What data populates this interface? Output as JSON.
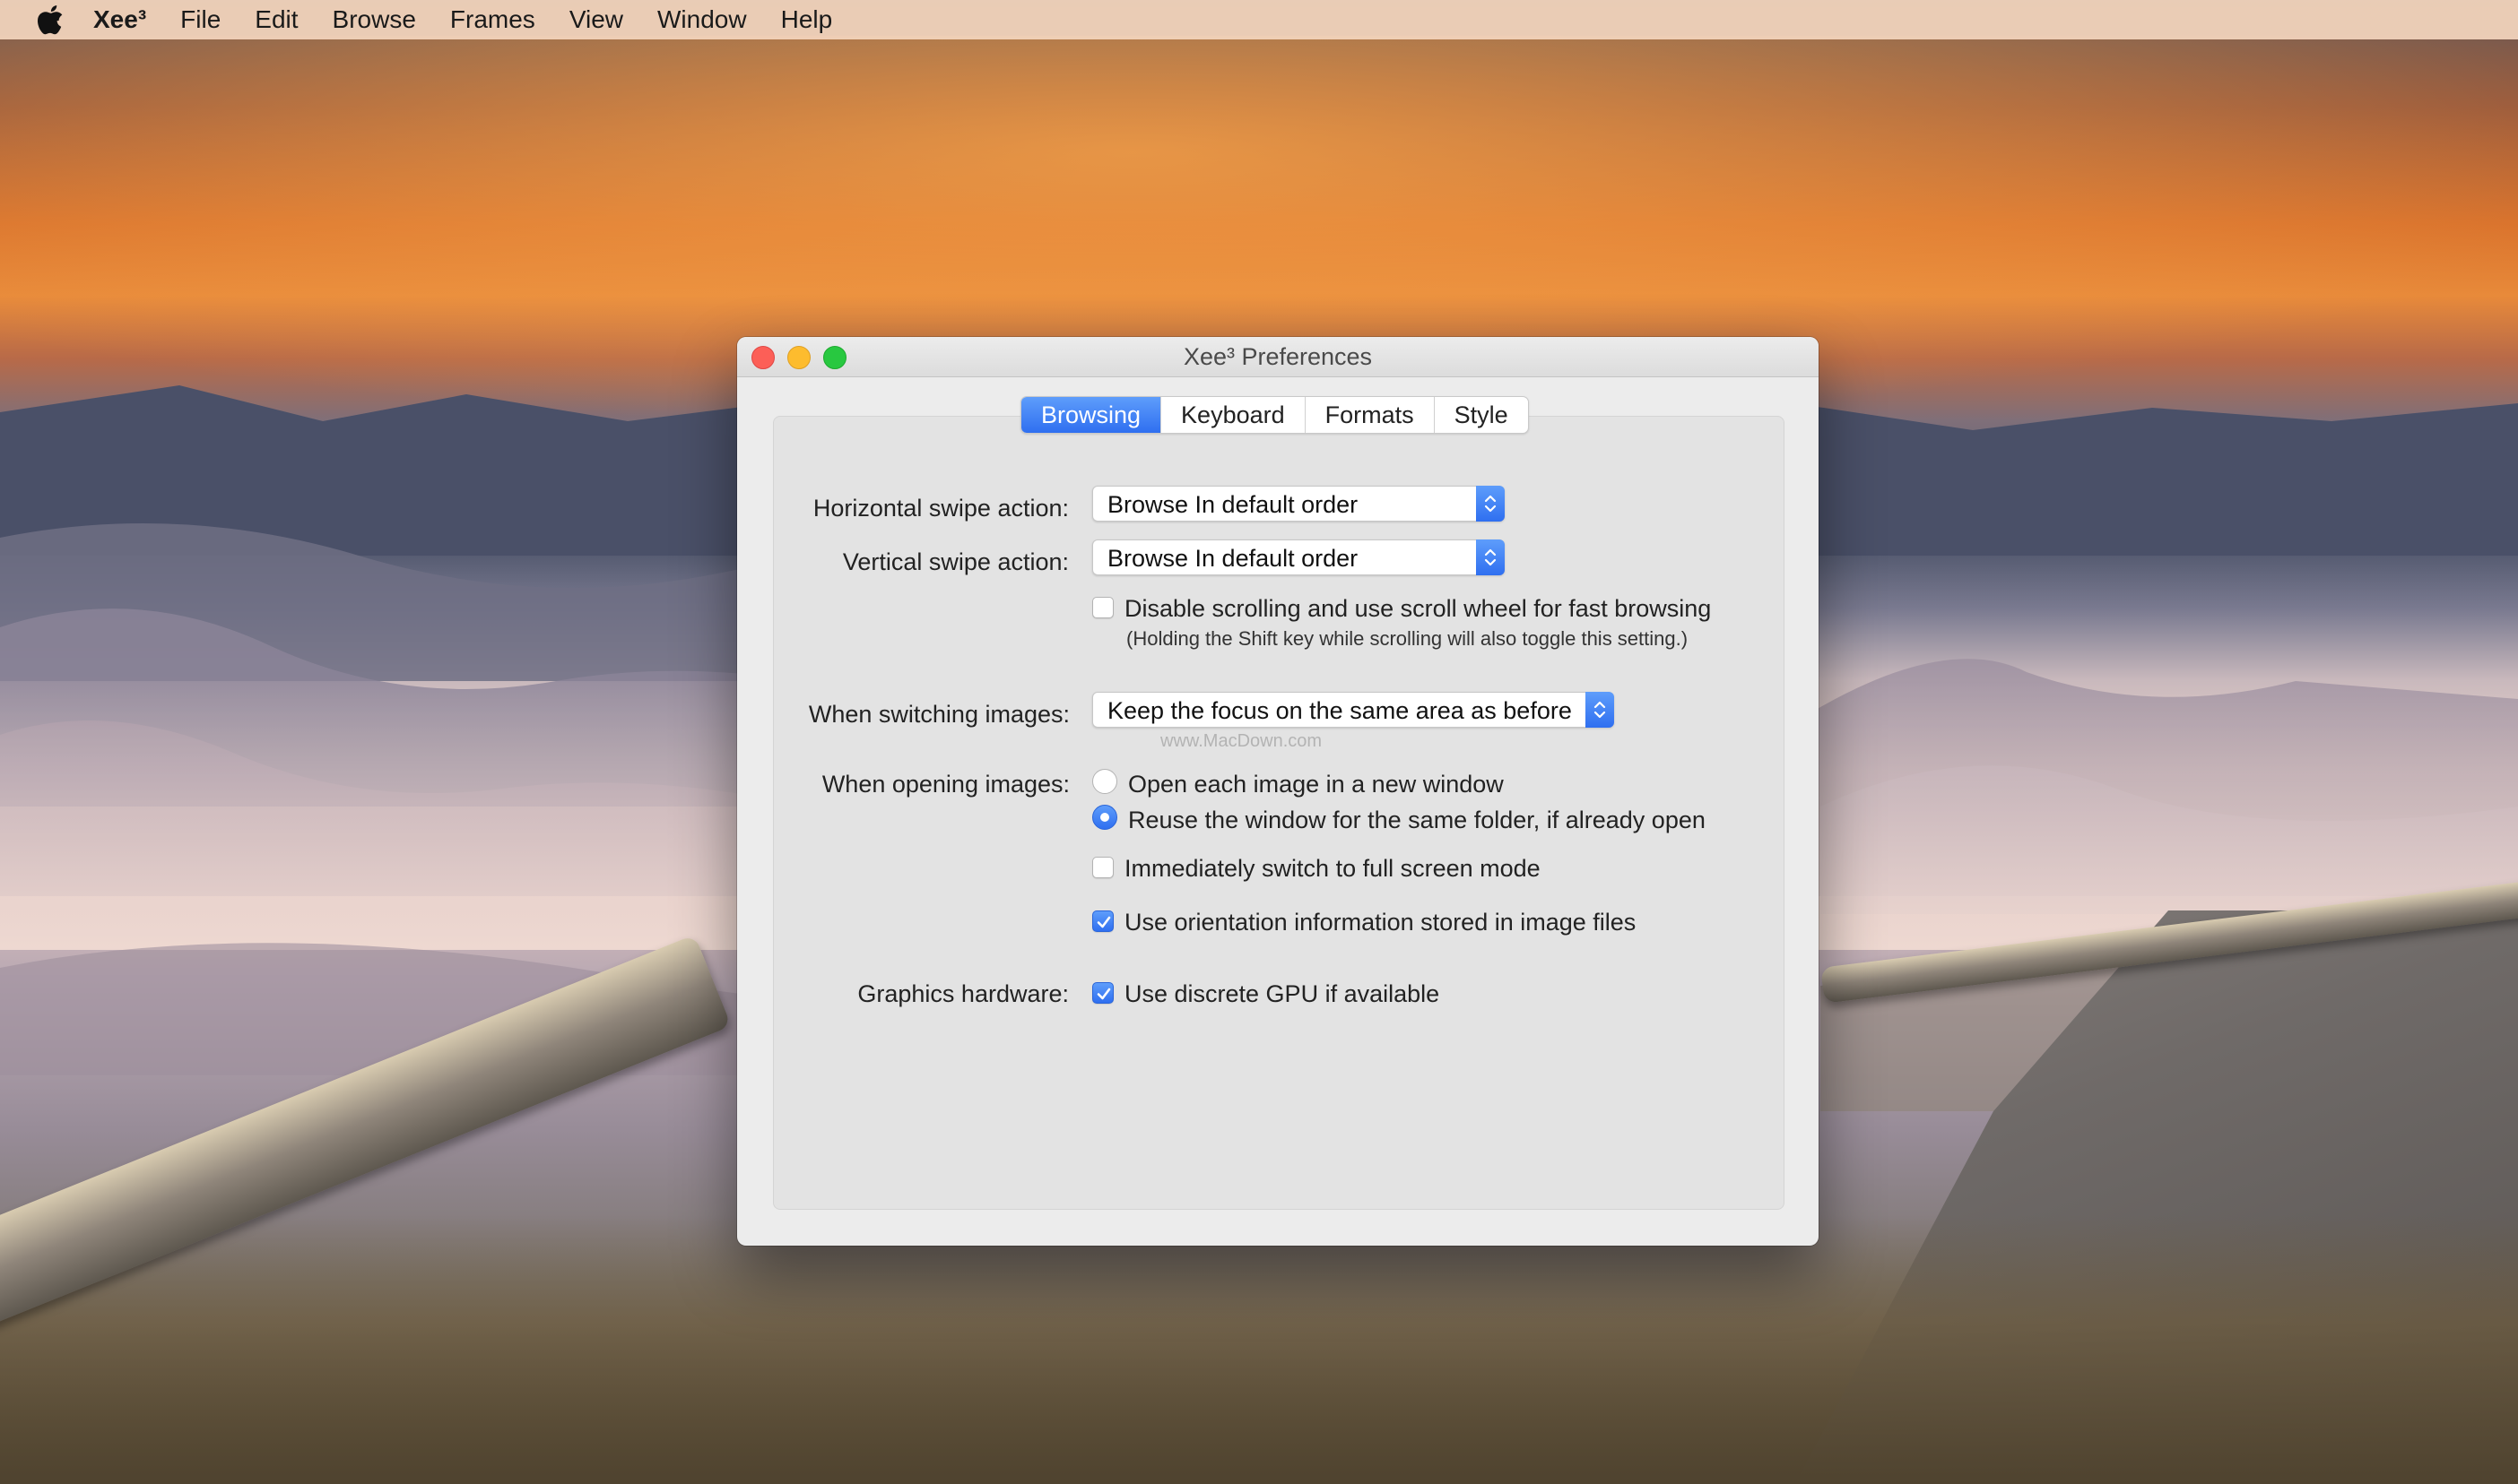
{
  "menubar": {
    "apple_icon": "apple-logo-icon",
    "app_name": "Xee³",
    "items": [
      "File",
      "Edit",
      "Browse",
      "Frames",
      "View",
      "Window",
      "Help"
    ]
  },
  "window": {
    "title": "Xee³ Preferences",
    "tabs": [
      {
        "label": "Browsing",
        "selected": true
      },
      {
        "label": "Keyboard",
        "selected": false
      },
      {
        "label": "Formats",
        "selected": false
      },
      {
        "label": "Style",
        "selected": false
      }
    ],
    "horizontal_swipe": {
      "label": "Horizontal swipe action:",
      "value": "Browse In default order"
    },
    "vertical_swipe": {
      "label": "Vertical swipe action:",
      "value": "Browse In default order"
    },
    "disable_scrolling": {
      "label": "Disable scrolling and use scroll wheel for fast browsing",
      "note": "(Holding the Shift key while scrolling will also toggle this setting.)",
      "checked": false
    },
    "switching_images": {
      "label": "When switching images:",
      "value": "Keep the focus on the same area as before"
    },
    "watermark": "www.MacDown.com",
    "opening_images": {
      "label": "When opening images:",
      "options": [
        {
          "label": "Open each image in a new window",
          "selected": false
        },
        {
          "label": "Reuse the window for the same folder, if already open",
          "selected": true
        }
      ]
    },
    "full_screen": {
      "label": "Immediately switch to full screen mode",
      "checked": false
    },
    "orientation": {
      "label": "Use orientation information stored in image files",
      "checked": true
    },
    "graphics": {
      "label": "Graphics hardware:",
      "option": {
        "label": "Use discrete GPU if available",
        "checked": true
      }
    }
  },
  "colors": {
    "accent": "#2f6ff0",
    "close": "#fc5f57",
    "minimize": "#fdbc2e",
    "maximize": "#28c840"
  }
}
